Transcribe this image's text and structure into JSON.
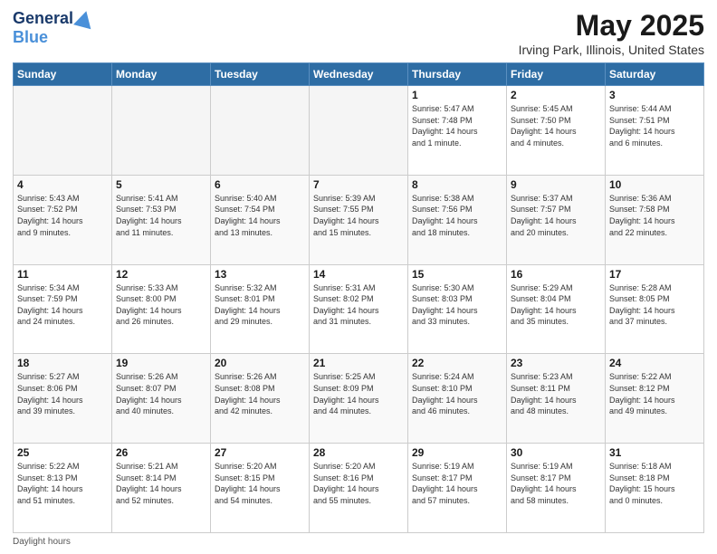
{
  "header": {
    "logo_general": "General",
    "logo_blue": "Blue",
    "title": "May 2025",
    "subtitle": "Irving Park, Illinois, United States"
  },
  "days_of_week": [
    "Sunday",
    "Monday",
    "Tuesday",
    "Wednesday",
    "Thursday",
    "Friday",
    "Saturday"
  ],
  "weeks": [
    [
      {
        "day": "",
        "info": ""
      },
      {
        "day": "",
        "info": ""
      },
      {
        "day": "",
        "info": ""
      },
      {
        "day": "",
        "info": ""
      },
      {
        "day": "1",
        "info": "Sunrise: 5:47 AM\nSunset: 7:48 PM\nDaylight: 14 hours\nand 1 minute."
      },
      {
        "day": "2",
        "info": "Sunrise: 5:45 AM\nSunset: 7:50 PM\nDaylight: 14 hours\nand 4 minutes."
      },
      {
        "day": "3",
        "info": "Sunrise: 5:44 AM\nSunset: 7:51 PM\nDaylight: 14 hours\nand 6 minutes."
      }
    ],
    [
      {
        "day": "4",
        "info": "Sunrise: 5:43 AM\nSunset: 7:52 PM\nDaylight: 14 hours\nand 9 minutes."
      },
      {
        "day": "5",
        "info": "Sunrise: 5:41 AM\nSunset: 7:53 PM\nDaylight: 14 hours\nand 11 minutes."
      },
      {
        "day": "6",
        "info": "Sunrise: 5:40 AM\nSunset: 7:54 PM\nDaylight: 14 hours\nand 13 minutes."
      },
      {
        "day": "7",
        "info": "Sunrise: 5:39 AM\nSunset: 7:55 PM\nDaylight: 14 hours\nand 15 minutes."
      },
      {
        "day": "8",
        "info": "Sunrise: 5:38 AM\nSunset: 7:56 PM\nDaylight: 14 hours\nand 18 minutes."
      },
      {
        "day": "9",
        "info": "Sunrise: 5:37 AM\nSunset: 7:57 PM\nDaylight: 14 hours\nand 20 minutes."
      },
      {
        "day": "10",
        "info": "Sunrise: 5:36 AM\nSunset: 7:58 PM\nDaylight: 14 hours\nand 22 minutes."
      }
    ],
    [
      {
        "day": "11",
        "info": "Sunrise: 5:34 AM\nSunset: 7:59 PM\nDaylight: 14 hours\nand 24 minutes."
      },
      {
        "day": "12",
        "info": "Sunrise: 5:33 AM\nSunset: 8:00 PM\nDaylight: 14 hours\nand 26 minutes."
      },
      {
        "day": "13",
        "info": "Sunrise: 5:32 AM\nSunset: 8:01 PM\nDaylight: 14 hours\nand 29 minutes."
      },
      {
        "day": "14",
        "info": "Sunrise: 5:31 AM\nSunset: 8:02 PM\nDaylight: 14 hours\nand 31 minutes."
      },
      {
        "day": "15",
        "info": "Sunrise: 5:30 AM\nSunset: 8:03 PM\nDaylight: 14 hours\nand 33 minutes."
      },
      {
        "day": "16",
        "info": "Sunrise: 5:29 AM\nSunset: 8:04 PM\nDaylight: 14 hours\nand 35 minutes."
      },
      {
        "day": "17",
        "info": "Sunrise: 5:28 AM\nSunset: 8:05 PM\nDaylight: 14 hours\nand 37 minutes."
      }
    ],
    [
      {
        "day": "18",
        "info": "Sunrise: 5:27 AM\nSunset: 8:06 PM\nDaylight: 14 hours\nand 39 minutes."
      },
      {
        "day": "19",
        "info": "Sunrise: 5:26 AM\nSunset: 8:07 PM\nDaylight: 14 hours\nand 40 minutes."
      },
      {
        "day": "20",
        "info": "Sunrise: 5:26 AM\nSunset: 8:08 PM\nDaylight: 14 hours\nand 42 minutes."
      },
      {
        "day": "21",
        "info": "Sunrise: 5:25 AM\nSunset: 8:09 PM\nDaylight: 14 hours\nand 44 minutes."
      },
      {
        "day": "22",
        "info": "Sunrise: 5:24 AM\nSunset: 8:10 PM\nDaylight: 14 hours\nand 46 minutes."
      },
      {
        "day": "23",
        "info": "Sunrise: 5:23 AM\nSunset: 8:11 PM\nDaylight: 14 hours\nand 48 minutes."
      },
      {
        "day": "24",
        "info": "Sunrise: 5:22 AM\nSunset: 8:12 PM\nDaylight: 14 hours\nand 49 minutes."
      }
    ],
    [
      {
        "day": "25",
        "info": "Sunrise: 5:22 AM\nSunset: 8:13 PM\nDaylight: 14 hours\nand 51 minutes."
      },
      {
        "day": "26",
        "info": "Sunrise: 5:21 AM\nSunset: 8:14 PM\nDaylight: 14 hours\nand 52 minutes."
      },
      {
        "day": "27",
        "info": "Sunrise: 5:20 AM\nSunset: 8:15 PM\nDaylight: 14 hours\nand 54 minutes."
      },
      {
        "day": "28",
        "info": "Sunrise: 5:20 AM\nSunset: 8:16 PM\nDaylight: 14 hours\nand 55 minutes."
      },
      {
        "day": "29",
        "info": "Sunrise: 5:19 AM\nSunset: 8:17 PM\nDaylight: 14 hours\nand 57 minutes."
      },
      {
        "day": "30",
        "info": "Sunrise: 5:19 AM\nSunset: 8:17 PM\nDaylight: 14 hours\nand 58 minutes."
      },
      {
        "day": "31",
        "info": "Sunrise: 5:18 AM\nSunset: 8:18 PM\nDaylight: 15 hours\nand 0 minutes."
      }
    ]
  ],
  "footer": {
    "note": "Daylight hours"
  }
}
